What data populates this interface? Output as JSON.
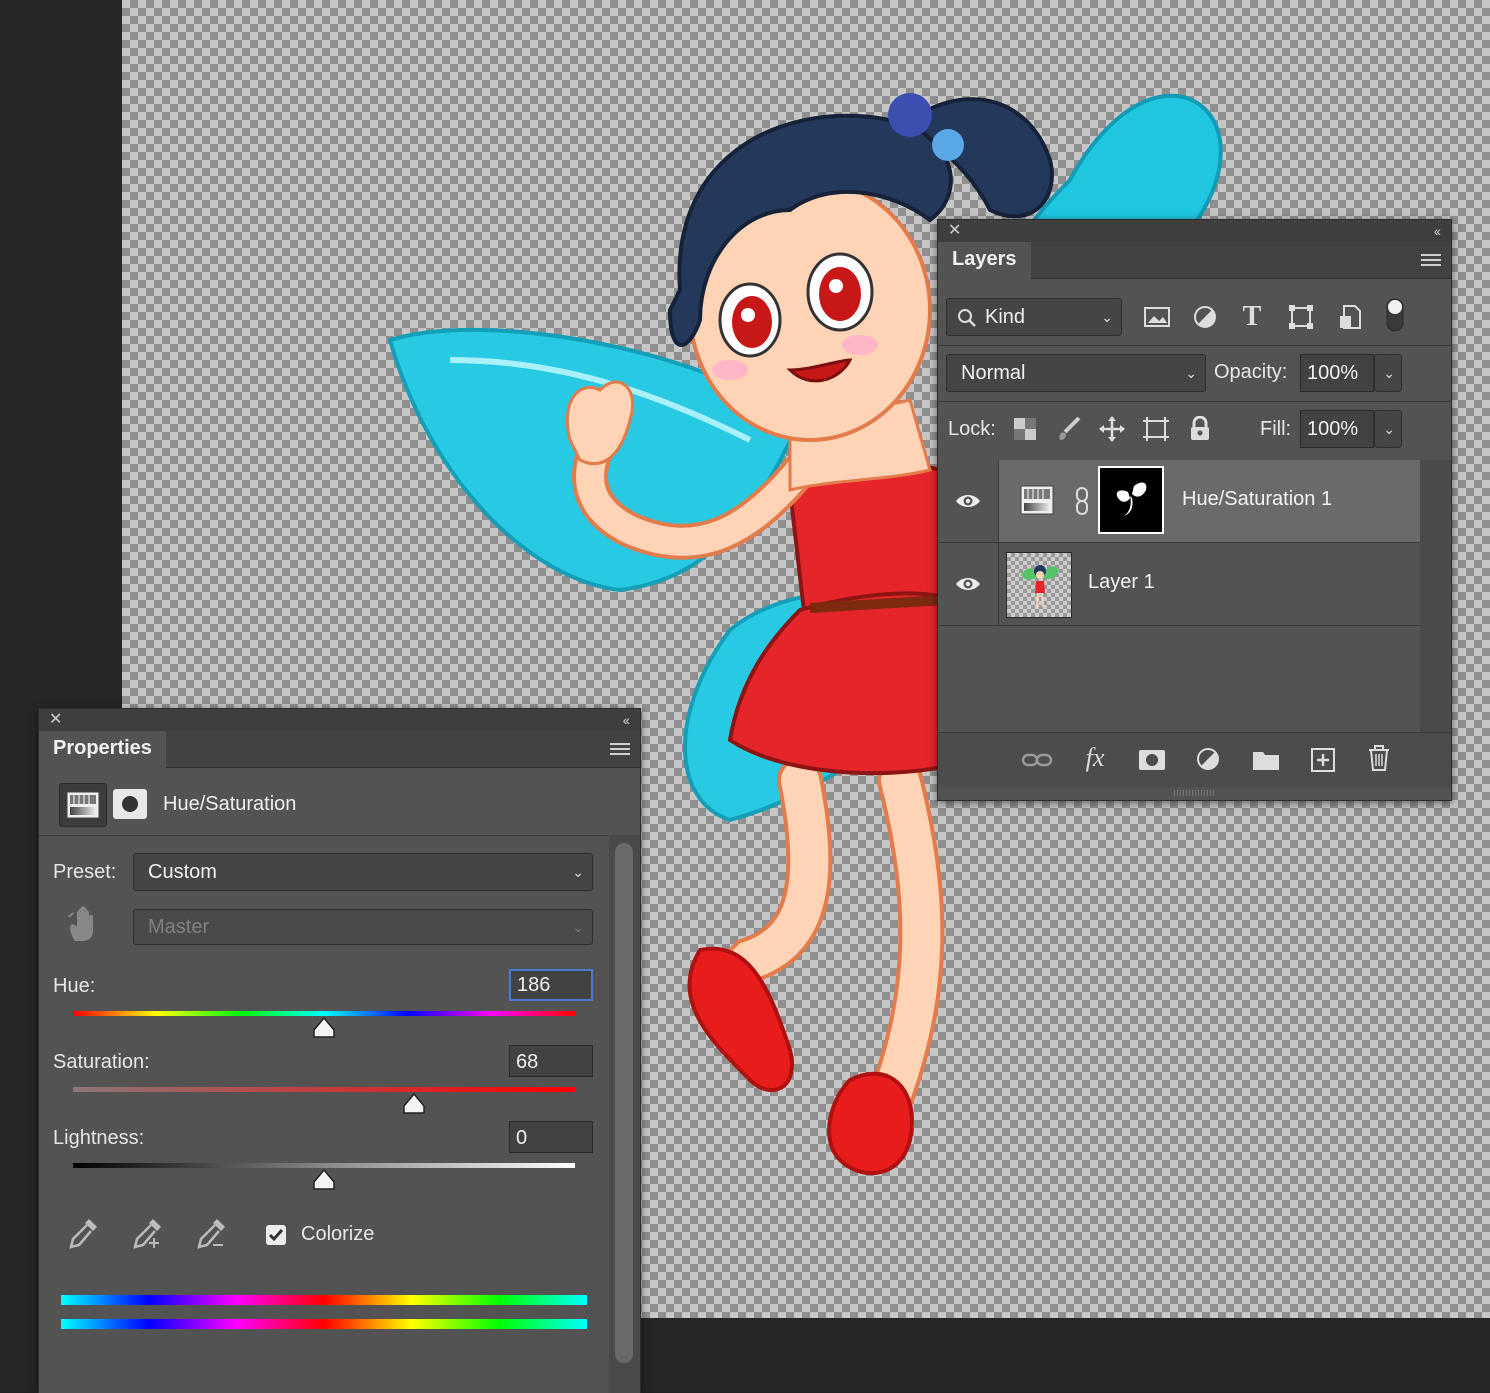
{
  "layers_panel": {
    "tab": "Layers",
    "filter_kind": "Kind",
    "blend_mode": "Normal",
    "opacity_label": "Opacity:",
    "opacity_value": "100%",
    "lock_label": "Lock:",
    "fill_label": "Fill:",
    "fill_value": "100%",
    "filter_icons": [
      "image-filter-icon",
      "adjustment-filter-icon",
      "type-filter-icon",
      "shape-filter-icon",
      "smart-object-filter-icon",
      "filter-toggle-icon"
    ],
    "lock_icons": [
      "lock-transparent-icon",
      "lock-image-icon",
      "lock-position-icon",
      "lock-artboard-icon",
      "lock-all-icon"
    ],
    "layers": [
      {
        "name": "Hue/Saturation 1",
        "visible": true,
        "selected": true
      },
      {
        "name": "Layer 1",
        "visible": true,
        "selected": false
      }
    ],
    "footer_icons": [
      "link-layers-icon",
      "fx-icon",
      "add-mask-icon",
      "new-adjustment-icon",
      "new-group-icon",
      "new-layer-icon",
      "delete-layer-icon"
    ],
    "fx_text": "fx"
  },
  "properties_panel": {
    "tab": "Properties",
    "adjustment_title": "Hue/Saturation",
    "preset_label": "Preset:",
    "preset_value": "Custom",
    "channel_value": "Master",
    "hue_label": "Hue:",
    "hue_value": "186",
    "hue_fraction": 0.5,
    "saturation_label": "Saturation:",
    "saturation_value": "68",
    "saturation_fraction": 0.68,
    "lightness_label": "Lightness:",
    "lightness_value": "0",
    "lightness_fraction": 0.5,
    "colorize_label": "Colorize",
    "colorize_checked": true
  },
  "colors": {
    "panel_bg": "#535353",
    "selected_layer": "#6a6a6a",
    "field_focus": "#4a7bd0"
  }
}
